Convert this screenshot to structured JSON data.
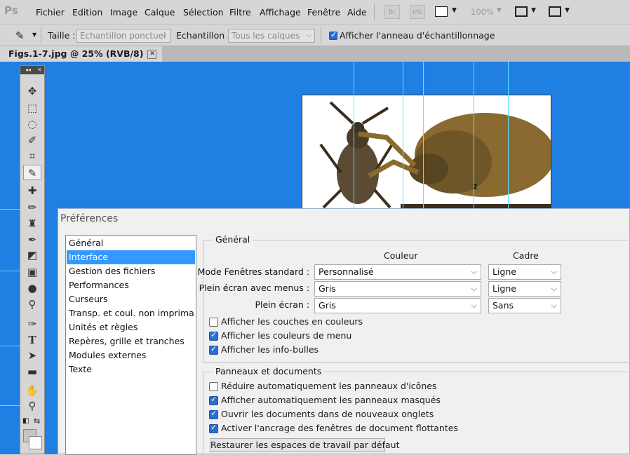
{
  "app": {
    "logo": "Ps"
  },
  "menu": [
    "Fichier",
    "Edition",
    "Image",
    "Calque",
    "Sélection",
    "Filtre",
    "Affichage",
    "Fenêtre",
    "Aide"
  ],
  "toolbar": {
    "br_label": "Br",
    "mb_label": "Mb",
    "zoom": "100%"
  },
  "options": {
    "size_label": "Taille :",
    "size_value": "Echantillon ponctuel",
    "sample_label": "Echantillon :",
    "sample_value": "Tous les calques",
    "ring_checked": true,
    "ring_label": "Afficher l'anneau d'échantillonnage"
  },
  "document": {
    "tab_title": "Figs.1-7.jpg @ 25% (RVB/8)",
    "close_glyph": "✕",
    "figure_number": "2"
  },
  "tools_panel": {
    "collapse": "◂◂",
    "close": "✕"
  },
  "preferences": {
    "title": "Préférences",
    "categories": [
      "Général",
      "Interface",
      "Gestion des fichiers",
      "Performances",
      "Curseurs",
      "Transp. et coul. non imprimables",
      "Unités et règles",
      "Repères, grille et tranches",
      "Modules externes",
      "Texte"
    ],
    "selected_category": "Interface",
    "general_section": {
      "legend": "Général",
      "col_color": "Couleur",
      "col_frame": "Cadre",
      "rows": [
        {
          "label": "Mode Fenêtres standard :",
          "color": "Personnalisé",
          "frame": "Ligne"
        },
        {
          "label": "Plein écran avec menus :",
          "color": "Gris",
          "frame": "Ligne"
        },
        {
          "label": "Plein écran :",
          "color": "Gris",
          "frame": "Sans"
        }
      ],
      "checkboxes": [
        {
          "label": "Afficher les couches en couleurs",
          "checked": false
        },
        {
          "label": "Afficher les couleurs de menu",
          "checked": true
        },
        {
          "label": "Afficher les info-bulles",
          "checked": true
        }
      ]
    },
    "panels_section": {
      "legend": "Panneaux et documents",
      "checkboxes": [
        {
          "label": "Réduire automatiquement les panneaux d'icônes",
          "checked": false
        },
        {
          "label": "Afficher automatiquement les panneaux masqués",
          "checked": true
        },
        {
          "label": "Ouvrir les documents dans de nouveaux onglets",
          "checked": true
        },
        {
          "label": "Activer l'ancrage des fenêtres de document flottantes",
          "checked": true
        }
      ],
      "restore_button": "Restaurer les espaces de travail par défaut"
    }
  },
  "colors": {
    "canvas": "#1f7fe2",
    "guide": "#5ce0ff",
    "selection": "#3399ff",
    "checkbox": "#2a6fd1"
  }
}
